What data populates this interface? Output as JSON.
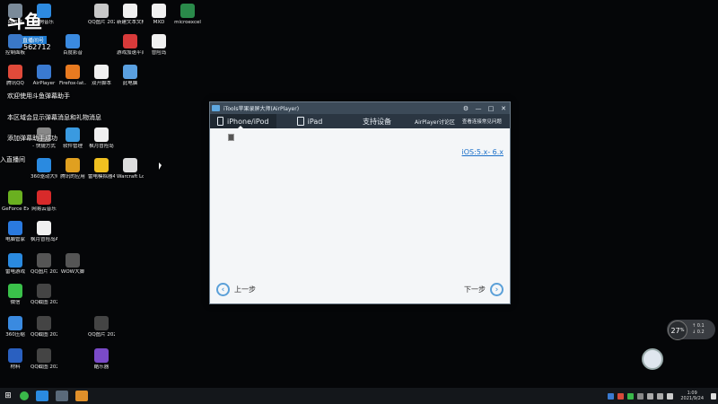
{
  "stream": {
    "logo_mark": "斗鱼",
    "logo_sub": "直播间号",
    "room_number": "562712"
  },
  "overlay": {
    "line1": "欢迎使用斗鱼弹幕助手",
    "line2": "本区域会显示弹幕消息和礼物消息",
    "line3": "添加弹幕助手成功",
    "line4": "入直播间"
  },
  "desktop_icons": [
    {
      "label": "回收站",
      "color": "#7a8a99"
    },
    {
      "label": "控制面板",
      "color": "#3a78c8"
    },
    {
      "label": "腾讯QQ",
      "color": "#e04a3a"
    },
    {
      "label": "AirPlayer",
      "color": "#3a7ad0"
    },
    {
      "label": "Firefox-lat...",
      "color": "#e87a20"
    },
    {
      "label": "双开脚本",
      "color": "#f0f0f0"
    },
    {
      "label": "此电脑",
      "color": "#5aa0e0"
    },
    {
      "label": "酷狗音乐",
      "color": "#2d8ae0"
    },
    {
      "label": "QQ图片 20210719...",
      "color": "#c8c8c8"
    },
    {
      "label": "新建文本文档",
      "color": "#f0f0f0"
    },
    {
      "label": "MXD",
      "color": "#f0f0f0"
    },
    {
      "label": "microexcel",
      "color": "#2a8a4a"
    },
    {
      "label": "百度影音",
      "color": "#3a8ae0"
    },
    {
      "label": "游戏加速平台",
      "color": "#d83a3a"
    },
    {
      "label": "冒险岛",
      "color": "#f0f0f0"
    },
    {
      "label": "- 快捷方式",
      "color": "#888888"
    },
    {
      "label": "软件管理",
      "color": "#3a9ae0"
    },
    {
      "label": "枫月冒险岛",
      "color": "#f0f0f0"
    },
    {
      "label": "360驱动大师",
      "color": "#2a8ae0"
    },
    {
      "label": "腾讯的应用",
      "color": "#e0a020"
    },
    {
      "label": "雷电模拟器4",
      "color": "#f0c020"
    },
    {
      "label": "Warcraft Logs U...",
      "color": "#dddddd"
    },
    {
      "label": "GeForce Experience",
      "color": "#6ab020"
    },
    {
      "label": "网易云音乐",
      "color": "#d82a2a"
    },
    {
      "label": "电脑管家",
      "color": "#2a7ae0"
    },
    {
      "label": "枫月冒险岛A",
      "color": "#f0f0f0"
    },
    {
      "label": "雷电游戏",
      "color": "#2a8ae0"
    },
    {
      "label": "QQ图片 20210704...",
      "color": "#555555"
    },
    {
      "label": "WOW大脚",
      "color": "#555555"
    },
    {
      "label": "微信",
      "color": "#3ac04a"
    },
    {
      "label": "QQ截图 20210605...",
      "color": "#444444"
    },
    {
      "label": "360压缩",
      "color": "#3a8ae0"
    },
    {
      "label": "QQ截图 20210605...",
      "color": "#444444"
    },
    {
      "label": "QQ图片 20210722...",
      "color": "#444444"
    },
    {
      "label": "材料",
      "color": "#2a60c0"
    },
    {
      "label": "QQ截图 20210605...",
      "color": "#444444"
    },
    {
      "label": "酷乐器",
      "color": "#7a4ac8"
    }
  ],
  "window": {
    "title": "iTools苹果录屏大师(AirPlayer)",
    "controls": [
      "⚙",
      "—",
      "□",
      "✕"
    ],
    "tabs": {
      "iphone": "iPhone/iPod",
      "ipad": "iPad",
      "support": "支持设备",
      "forum": "AirPlayer讨论区",
      "help": "查看连接常见问题"
    },
    "ios_link": "iOS:5.x- 6.x",
    "prev_label": "上一步",
    "next_label": "下一步"
  },
  "widget": {
    "percent": "27",
    "unit": "%",
    "up": "0.1",
    "down": "0.2"
  },
  "clock": {
    "time": "1:09",
    "date": "2021/9/24"
  }
}
